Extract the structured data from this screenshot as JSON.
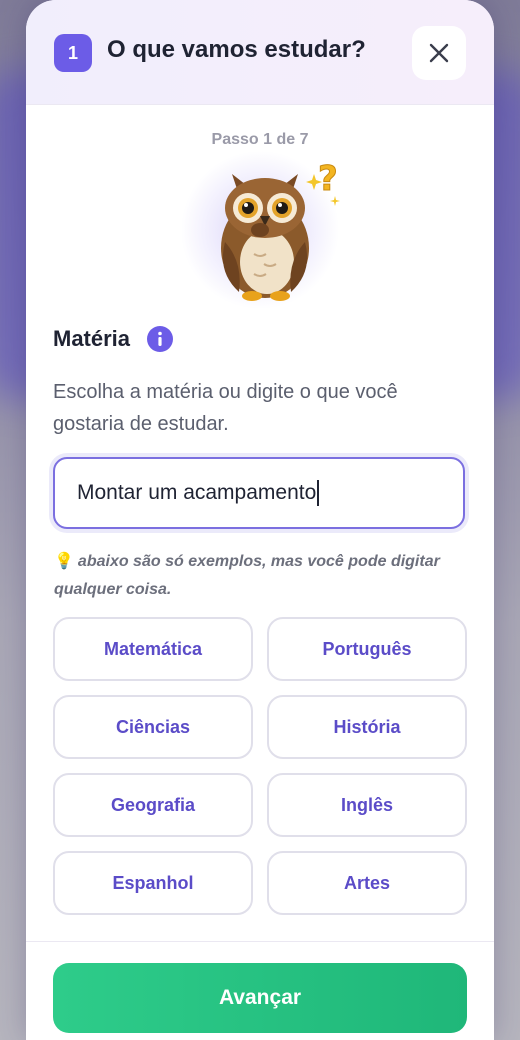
{
  "header": {
    "step_number": "1",
    "title": "O que vamos estudar?",
    "close_icon": "close-icon"
  },
  "progress": {
    "label": "Passo 1 de 7",
    "current": 1,
    "total": 7
  },
  "mascot": {
    "icon": "thinking-owl-icon"
  },
  "section": {
    "title": "Matéria",
    "info_icon": "info-icon",
    "description": "Escolha a matéria ou digite o que você gostaria de estudar."
  },
  "input": {
    "value": "Montar um acampamento"
  },
  "hint": {
    "icon": "lightbulb-icon",
    "text": "abaixo são só exemplos, mas você pode digitar qualquer coisa."
  },
  "subjects": [
    {
      "label": "Matemática"
    },
    {
      "label": "Português"
    },
    {
      "label": "Ciências"
    },
    {
      "label": "História"
    },
    {
      "label": "Geografia"
    },
    {
      "label": "Inglês"
    },
    {
      "label": "Espanhol"
    },
    {
      "label": "Artes"
    }
  ],
  "footer": {
    "next_label": "Avançar"
  },
  "colors": {
    "accent": "#6c5ce7",
    "chip_text": "#5b4cc8",
    "primary_button": "#22c07f",
    "title_text": "#1f2333"
  }
}
